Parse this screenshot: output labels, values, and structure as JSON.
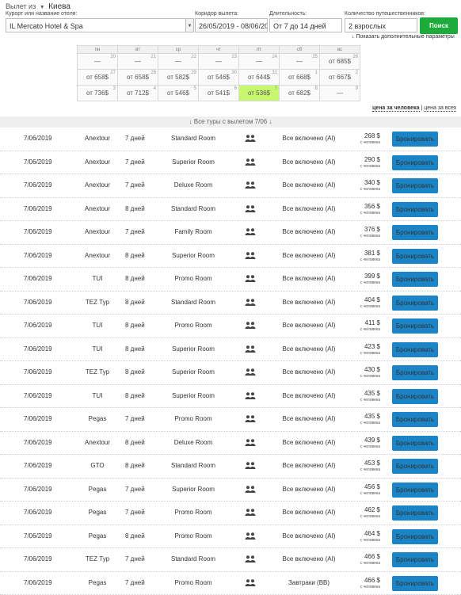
{
  "header": {
    "departure_prefix": "Вылет из",
    "departure_city": "Киева",
    "labels": {
      "hotel": "Курорт или название отеля:",
      "dates": "Коридор вылета:",
      "duration": "Длительность:",
      "travelers": "Количество путешественников:"
    },
    "values": {
      "hotel": "IL Mercato Hotel & Spa",
      "dates": "26/05/2019 - 08/06/2019",
      "duration": "От 7 до 14 дней",
      "travelers": "2 взрослых"
    },
    "search_label": "Поиск",
    "advanced_link": "↓ Показать дополнительные параметры"
  },
  "calendar": {
    "weekdays": [
      "пн",
      "вт",
      "ср",
      "чт",
      "пт",
      "сб",
      "вс"
    ],
    "weeks": [
      [
        {
          "day": "20",
          "price": "—"
        },
        {
          "day": "21",
          "price": "—"
        },
        {
          "day": "22",
          "price": "—"
        },
        {
          "day": "23",
          "price": "—"
        },
        {
          "day": "24",
          "price": "—"
        },
        {
          "day": "25",
          "price": "—"
        },
        {
          "day": "26",
          "price": "от 685$"
        }
      ],
      [
        {
          "day": "27",
          "price": "от 658$"
        },
        {
          "day": "28",
          "price": "от 658$"
        },
        {
          "day": "29",
          "price": "от 582$"
        },
        {
          "day": "30",
          "price": "от 546$"
        },
        {
          "day": "31",
          "price": "от 644$"
        },
        {
          "day": "1",
          "price": "от 668$"
        },
        {
          "day": "2",
          "price": "от 667$"
        }
      ],
      [
        {
          "day": "3",
          "price": "от 736$"
        },
        {
          "day": "4",
          "price": "от 712$"
        },
        {
          "day": "5",
          "price": "от 546$"
        },
        {
          "day": "6",
          "price": "от 541$"
        },
        {
          "day": "7",
          "price": "от 536$"
        },
        {
          "day": "8",
          "price": "от 682$"
        },
        {
          "day": "9",
          "price": "—"
        }
      ]
    ],
    "price_per_person": "цена за человека",
    "separator": " | ",
    "price_total": "цена за всех"
  },
  "section_title": "↓ Все туры с вылетом 7/06 ↓",
  "book_label": "Бронировать",
  "price_note": "с человека",
  "tours": [
    {
      "date": "7/06/2019",
      "operator": "Anextour",
      "nights": "7 дней",
      "room": "Standard Room",
      "meal": "Все включено (AI)",
      "price": "268 $"
    },
    {
      "date": "7/06/2019",
      "operator": "Anextour",
      "nights": "7 дней",
      "room": "Superior Room",
      "meal": "Все включено (AI)",
      "price": "290 $"
    },
    {
      "date": "7/06/2019",
      "operator": "Anextour",
      "nights": "7 дней",
      "room": "Deluxe Room",
      "meal": "Все включено (AI)",
      "price": "340 $"
    },
    {
      "date": "7/06/2019",
      "operator": "Anextour",
      "nights": "8 дней",
      "room": "Standard Room",
      "meal": "Все включено (AI)",
      "price": "356 $"
    },
    {
      "date": "7/06/2019",
      "operator": "Anextour",
      "nights": "7 дней",
      "room": "Family Room",
      "meal": "Все включено (AI)",
      "price": "376 $"
    },
    {
      "date": "7/06/2019",
      "operator": "Anextour",
      "nights": "8 дней",
      "room": "Superior Room",
      "meal": "Все включено (AI)",
      "price": "381 $"
    },
    {
      "date": "7/06/2019",
      "operator": "TUI",
      "nights": "8 дней",
      "room": "Promo Room",
      "meal": "Все включено (AI)",
      "price": "399 $"
    },
    {
      "date": "7/06/2019",
      "operator": "TEZ Тур",
      "nights": "8 дней",
      "room": "Standard Room",
      "meal": "Все включено (AI)",
      "price": "404 $"
    },
    {
      "date": "7/06/2019",
      "operator": "TUI",
      "nights": "8 дней",
      "room": "Promo Room",
      "meal": "Все включено (AI)",
      "price": "411 $"
    },
    {
      "date": "7/06/2019",
      "operator": "TUI",
      "nights": "8 дней",
      "room": "Superior Room",
      "meal": "Все включено (AI)",
      "price": "423 $"
    },
    {
      "date": "7/06/2019",
      "operator": "TEZ Тур",
      "nights": "8 дней",
      "room": "Superior Room",
      "meal": "Все включено (AI)",
      "price": "430 $"
    },
    {
      "date": "7/06/2019",
      "operator": "TUI",
      "nights": "8 дней",
      "room": "Superior Room",
      "meal": "Все включено (AI)",
      "price": "435 $"
    },
    {
      "date": "7/06/2019",
      "operator": "Pegas",
      "nights": "7 дней",
      "room": "Promo Room",
      "meal": "Все включено (AI)",
      "price": "435 $"
    },
    {
      "date": "7/06/2019",
      "operator": "Anextour",
      "nights": "8 дней",
      "room": "Deluxe Room",
      "meal": "Все включено (AI)",
      "price": "439 $"
    },
    {
      "date": "7/06/2019",
      "operator": "GTO",
      "nights": "8 дней",
      "room": "Standard Room",
      "meal": "Все включено (AI)",
      "price": "453 $"
    },
    {
      "date": "7/06/2019",
      "operator": "Pegas",
      "nights": "7 дней",
      "room": "Superior Room",
      "meal": "Все включено (AI)",
      "price": "456 $"
    },
    {
      "date": "7/06/2019",
      "operator": "Pegas",
      "nights": "7 дней",
      "room": "Promo Room",
      "meal": "Все включено (AI)",
      "price": "462 $"
    },
    {
      "date": "7/06/2019",
      "operator": "Pegas",
      "nights": "8 дней",
      "room": "Promo Room",
      "meal": "Все включено (AI)",
      "price": "464 $"
    },
    {
      "date": "7/06/2019",
      "operator": "TEZ Тур",
      "nights": "7 дней",
      "room": "Standard Room",
      "meal": "Все включено (AI)",
      "price": "466 $"
    },
    {
      "date": "7/06/2019",
      "operator": "Pegas",
      "nights": "7 дней",
      "room": "Promo Room",
      "meal": "Завтраки (BB)",
      "price": "466 $"
    }
  ],
  "colors": {
    "accent": "#1a84c7",
    "search": "#1dab3c",
    "highlight": "#c6f76e"
  }
}
